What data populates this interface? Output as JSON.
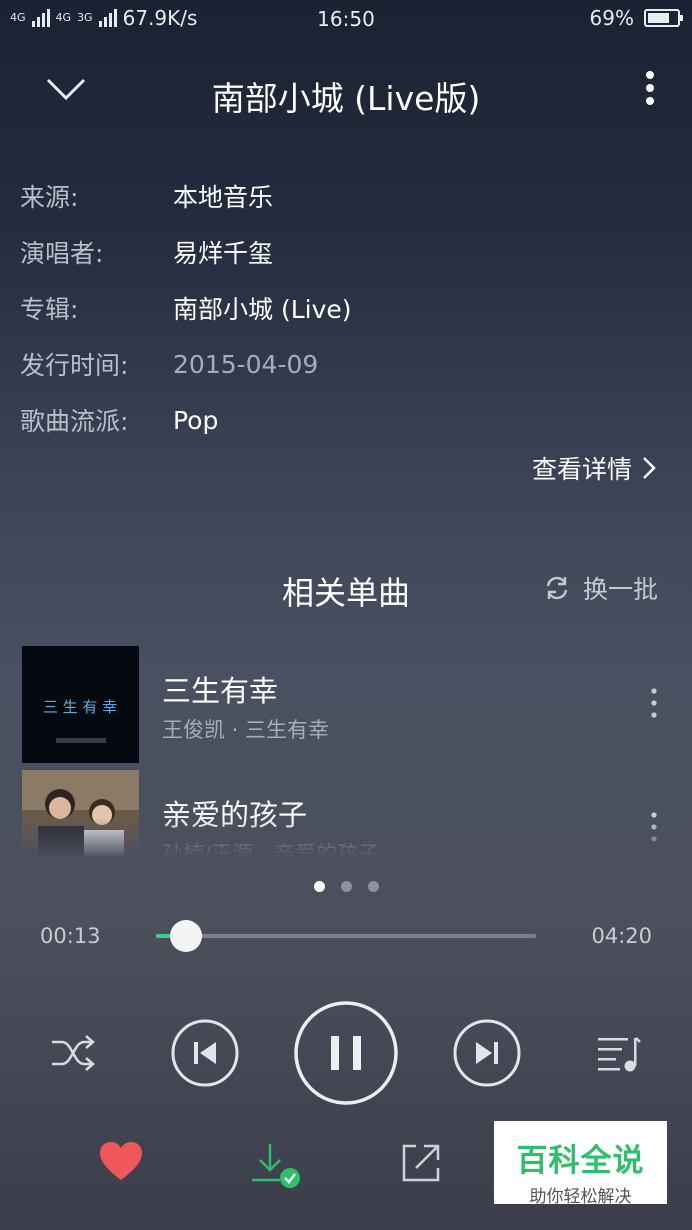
{
  "status_bar": {
    "network_tags": [
      "4G",
      "4G",
      "3G"
    ],
    "speed": "67.9K/s",
    "time": "16:50",
    "battery_percent": "69%",
    "battery_level": 0.69
  },
  "header": {
    "title": "南部小城 (Live版)",
    "collapse_icon": "chevron-down-icon",
    "more_icon": "more-vertical-icon"
  },
  "song_info": [
    {
      "label": "来源:",
      "value": "本地音乐"
    },
    {
      "label": "演唱者:",
      "value": "易烊千玺"
    },
    {
      "label": "专辑:",
      "value": "南部小城 (Live)"
    },
    {
      "label": "发行时间:",
      "value": "2015-04-09"
    },
    {
      "label": "歌曲流派:",
      "value": "Pop"
    }
  ],
  "details_link": "查看详情",
  "related": {
    "title": "相关单曲",
    "refresh_label": "换一批",
    "tracks": [
      {
        "title": "三生有幸",
        "subtitle": "王俊凯 · 三生有幸",
        "cover_text": "三 生 有 幸"
      },
      {
        "title": "亲爱的孩子",
        "subtitle": "孙楠/王源 - 亲爱的孩子"
      }
    ],
    "page_count": 3,
    "active_page": 1
  },
  "player": {
    "current_time": "00:13",
    "duration": "04:20",
    "progress": 0.05
  },
  "controls": {
    "shuffle_icon": "shuffle-icon",
    "prev_icon": "previous-track-icon",
    "pause_icon": "pause-icon",
    "next_icon": "next-track-icon",
    "playlist_icon": "playlist-icon"
  },
  "bottom_actions": {
    "favorite_icon": "heart-icon",
    "download_icon": "download-done-icon",
    "share_icon": "share-icon",
    "colors": {
      "favorite": "#f0575a",
      "download": "#2fbf6a"
    }
  },
  "watermark": {
    "line1": "百科全说",
    "line2": "助你轻松解决"
  }
}
